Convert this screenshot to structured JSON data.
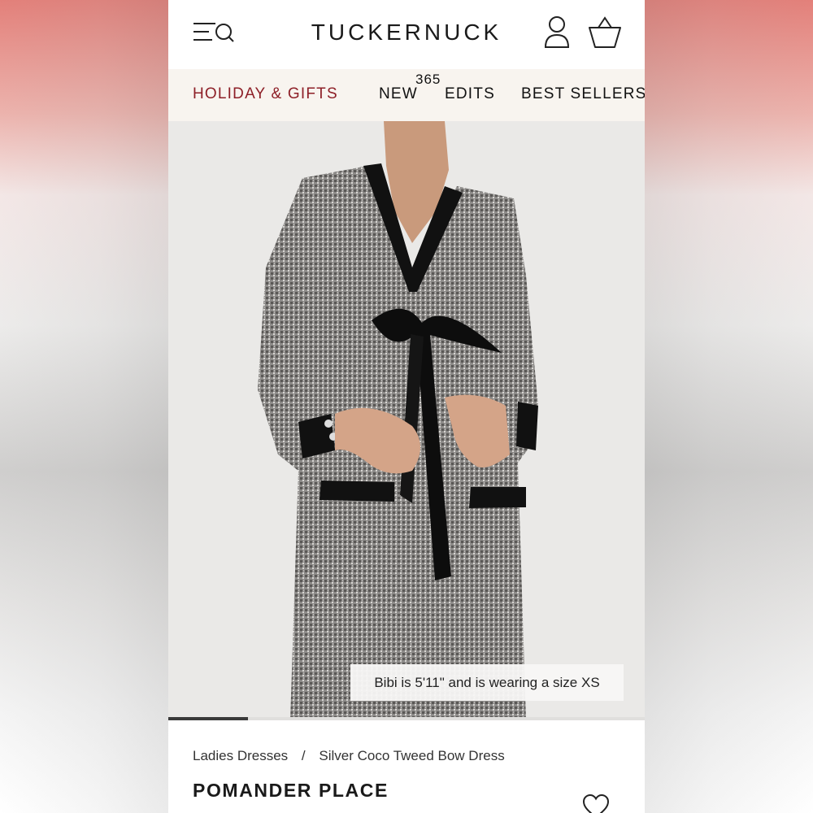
{
  "header": {
    "logo": "TUCKERNUCK",
    "icons": [
      "menu-search-icon",
      "account-icon",
      "shopping-bag-icon"
    ]
  },
  "nav": {
    "items": [
      {
        "label": "HOLIDAY & GIFTS",
        "color": "#8d1f27"
      },
      {
        "label": "NEW"
      },
      {
        "label": "EDITS",
        "badge": "365"
      },
      {
        "label": "BEST SELLERS"
      }
    ]
  },
  "gallery": {
    "caption": "Bibi is 5'11\" and is wearing a size XS",
    "progress_fraction": 0.167
  },
  "product": {
    "breadcrumb": {
      "category": "Ladies Dresses",
      "separator": "/",
      "current": "Silver Coco Tweed Bow Dress"
    },
    "brand": "POMANDER PLACE",
    "wishlist_icon": "heart-icon"
  },
  "colors": {
    "accent": "#8d1f27",
    "nav_bg": "#f8f4ef"
  }
}
